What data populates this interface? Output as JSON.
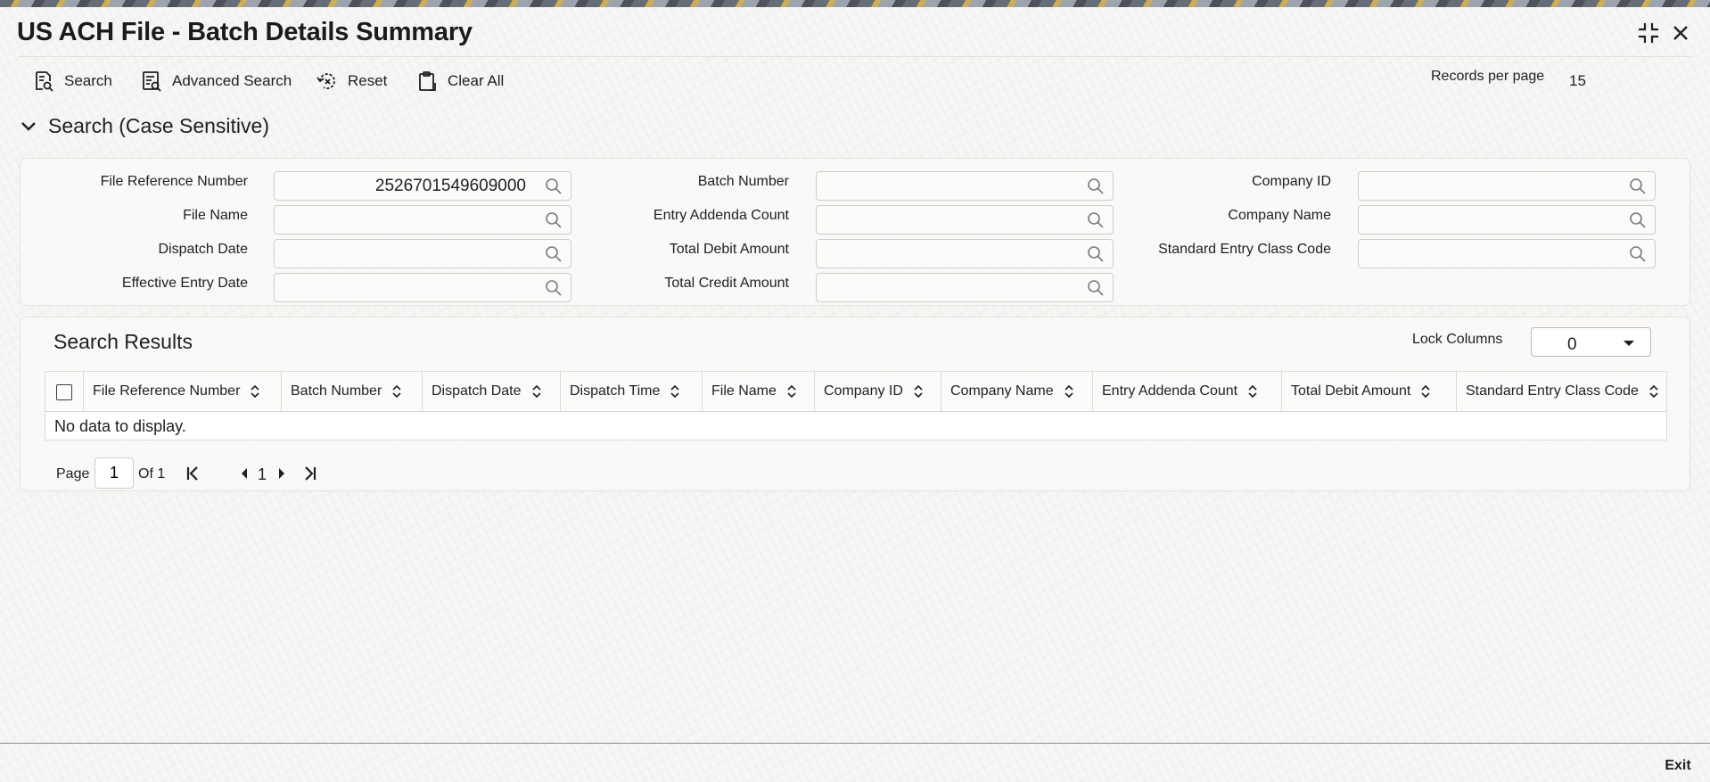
{
  "window": {
    "title": "US ACH File - Batch Details Summary",
    "collapse_icon": "collapse-icon",
    "close_icon": "close-icon"
  },
  "toolbar": {
    "search_label": "Search",
    "advanced_search_label": "Advanced Search",
    "reset_label": "Reset",
    "clear_all_label": "Clear All",
    "records_per_page_label": "Records per page",
    "records_per_page_value": "15"
  },
  "search": {
    "section_title": "Search (Case Sensitive)",
    "fields": {
      "file_reference_number": {
        "label": "File Reference Number",
        "value": "2526701549609000"
      },
      "file_name": {
        "label": "File Name",
        "value": ""
      },
      "dispatch_date": {
        "label": "Dispatch Date",
        "value": ""
      },
      "effective_entry_date": {
        "label": "Effective Entry Date",
        "value": ""
      },
      "batch_number": {
        "label": "Batch Number",
        "value": ""
      },
      "entry_addenda_count": {
        "label": "Entry Addenda Count",
        "value": ""
      },
      "total_debit_amount": {
        "label": "Total Debit Amount",
        "value": ""
      },
      "total_credit_amount": {
        "label": "Total Credit Amount",
        "value": ""
      },
      "company_id": {
        "label": "Company ID",
        "value": ""
      },
      "company_name": {
        "label": "Company Name",
        "value": ""
      },
      "standard_entry_class_code": {
        "label": "Standard Entry Class Code",
        "value": ""
      }
    }
  },
  "results": {
    "title": "Search Results",
    "lock_columns_label": "Lock Columns",
    "lock_columns_value": "0",
    "columns": [
      "File Reference Number",
      "Batch Number",
      "Dispatch Date",
      "Dispatch Time",
      "File Name",
      "Company ID",
      "Company Name",
      "Entry Addenda Count",
      "Total Debit Amount",
      "Standard Entry Class Code"
    ],
    "empty_message": "No data to display."
  },
  "pagination": {
    "page_label": "Page",
    "current_page": "1",
    "of_label": "Of 1",
    "page_number": "1"
  },
  "footer": {
    "exit_label": "Exit"
  },
  "colors": {
    "background": "#f7f6f4",
    "border": "#dcdad6",
    "text": "#1f1f1f"
  }
}
